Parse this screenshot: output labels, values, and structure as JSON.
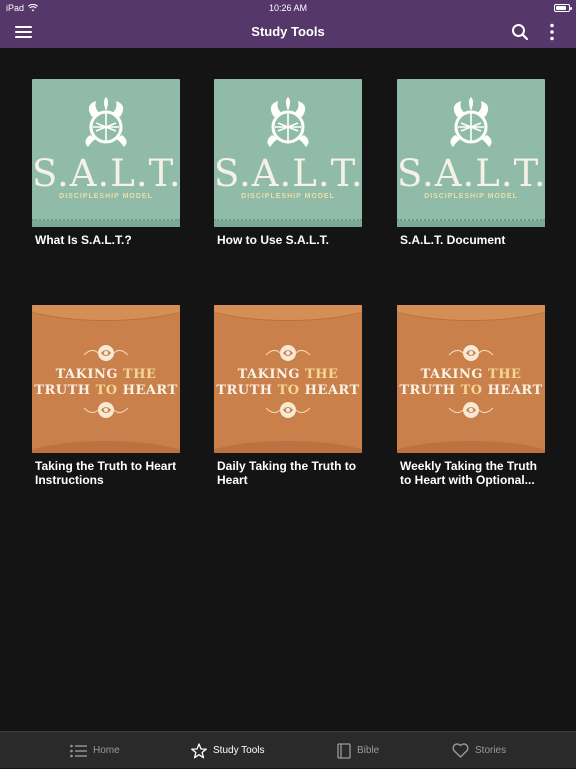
{
  "status_bar": {
    "carrier": "iPad",
    "time": "10:26 AM",
    "battery_level": 0.85
  },
  "header": {
    "title": "Study Tools",
    "menu_icon": "hamburger-menu-icon",
    "search_icon": "search-icon",
    "more_icon": "more-vertical-icon"
  },
  "items": [
    {
      "label": "What Is S.A.L.T.?",
      "thumb": "salt"
    },
    {
      "label": "How to Use S.A.L.T.",
      "thumb": "salt"
    },
    {
      "label": "S.A.L.T. Document",
      "thumb": "salt"
    },
    {
      "label": "Taking the Truth to Heart Instructions",
      "thumb": "ttth"
    },
    {
      "label": "Daily Taking the Truth to Heart",
      "thumb": "ttth"
    },
    {
      "label": "Weekly Taking the Truth to Heart with Optional...",
      "thumb": "ttth"
    }
  ],
  "salt_art": {
    "word": "S.A.L.T.",
    "subtitle": "DISCIPLESHIP MODEL"
  },
  "ttth_art": {
    "line1_a": "TAKING",
    "line1_b": "THE",
    "line2_a": "TRUTH",
    "line2_b": "TO",
    "line2_c": "HEART"
  },
  "tabs": [
    {
      "label": "Home",
      "icon": "list-icon",
      "active": false
    },
    {
      "label": "Study Tools",
      "icon": "star-icon",
      "active": true
    },
    {
      "label": "Bible",
      "icon": "book-icon",
      "active": false
    },
    {
      "label": "Stories",
      "icon": "heart-icon",
      "active": false
    }
  ],
  "colors": {
    "header": "#55376a",
    "background": "#141414",
    "tabbar": "#2a2a2a",
    "salt_thumb": "#8fbba8",
    "ttth_thumb": "#c9804a"
  }
}
